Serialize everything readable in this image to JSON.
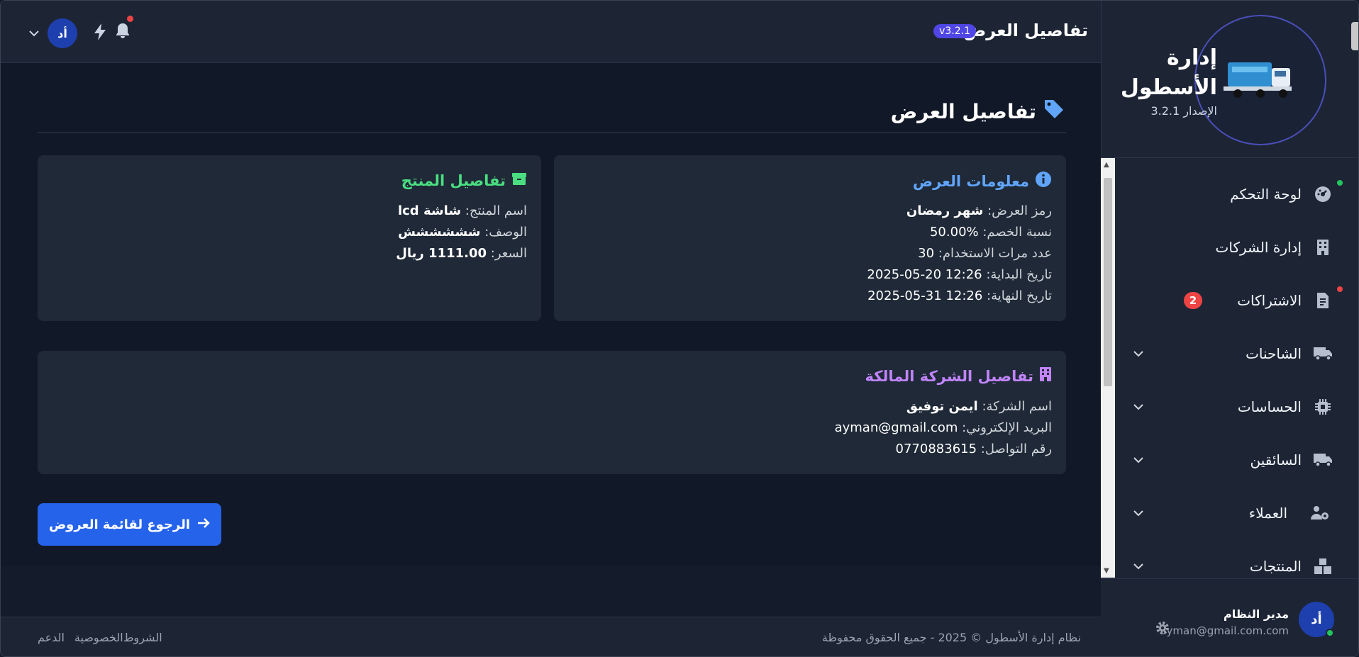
{
  "topbar": {
    "title": "تفاصيل العرض",
    "version_badge": "v3.2.1",
    "avatar_initials": "أد"
  },
  "brand": {
    "title": "إدارة الأسطول",
    "version": "الإصدار 3.2.1"
  },
  "sidebar": {
    "items": [
      {
        "label": "لوحة التحكم",
        "icon": "dashboard-icon",
        "dot": "#22c55e"
      },
      {
        "label": "إدارة الشركات",
        "icon": "building-icon"
      },
      {
        "label": "الاشتراكات",
        "icon": "invoice-icon",
        "badge": "2",
        "dot": "#ef4444"
      },
      {
        "label": "الشاحنات",
        "icon": "truck-icon",
        "expandable": true
      },
      {
        "label": "الحساسات",
        "icon": "chip-icon",
        "expandable": true
      },
      {
        "label": "السائقين",
        "icon": "truck-icon",
        "expandable": true
      },
      {
        "label": "العملاء",
        "icon": "users-gear-icon",
        "expandable": true
      },
      {
        "label": "المنتجات",
        "icon": "boxes-icon",
        "expandable": true
      }
    ]
  },
  "user": {
    "initials": "أد",
    "name": "مدير النظام",
    "email": "ayman@gmail.com.com"
  },
  "page": {
    "title": "تفاصيل العرض"
  },
  "offer_info": {
    "title": "معلومات العرض",
    "code_label": "رمز العرض:",
    "code_value": "شهر رمضان",
    "discount_label": "نسبة الخصم:",
    "discount_value": "50.00%",
    "uses_label": "عدد مرات الاستخدام:",
    "uses_value": "30",
    "start_label": "تاريخ البداية:",
    "start_value": "2025-05-20 12:26",
    "end_label": "تاريخ النهاية:",
    "end_value": "2025-05-31 12:26"
  },
  "product_info": {
    "title": "تفاصيل المنتج",
    "name_label": "اسم المنتج:",
    "name_value": "شاشة lcd",
    "desc_label": "الوصف:",
    "desc_value": "شششششش",
    "price_label": "السعر:",
    "price_value": "1111.00 ريال"
  },
  "company_info": {
    "title": "تفاصيل الشركة المالكة",
    "name_label": "اسم الشركة:",
    "name_value": "ايمن توفيق",
    "email_label": "البريد الإلكتروني:",
    "email_value": "ayman@gmail.com",
    "phone_label": "رقم التواصل:",
    "phone_value": "0770883615"
  },
  "back_button": "الرجوع لقائمة العروض",
  "footer": {
    "copyright": "نظام إدارة الأسطول © 2025 - جميع الحقوق محفوظة",
    "links": [
      "الدعم",
      "الخصوصية",
      "الشروط"
    ]
  },
  "colors": {
    "accent": "#2563eb",
    "offer_title": "#60a5fa",
    "product_title": "#4ade80",
    "company_title": "#c084fc"
  }
}
